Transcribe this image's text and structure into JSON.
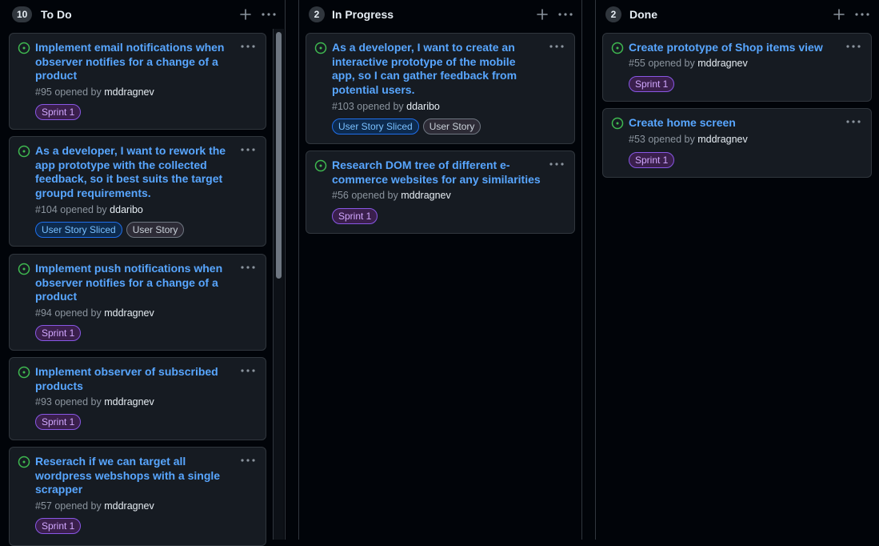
{
  "columns": {
    "todo": {
      "count": "10",
      "title": "To Do",
      "cards": [
        {
          "title_lines": [
            "Implement email notifications when",
            "observer notifies for a change of a",
            "product"
          ],
          "number": "#95",
          "opened_by_text": "opened by",
          "author": "mddragnev",
          "labels": [
            "Sprint 1"
          ]
        },
        {
          "title_lines": [
            "As a developer, I want to rework the",
            "app prototype with the collected",
            "feedback, so it best suits the target",
            "groupd requirements."
          ],
          "number": "#104",
          "opened_by_text": "opened by",
          "author": "ddaribo",
          "labels": [
            "User Story Sliced",
            "User Story"
          ]
        },
        {
          "title_lines": [
            "Implement push notifications when",
            "observer notifies for a change of a",
            "product"
          ],
          "number": "#94",
          "opened_by_text": "opened by",
          "author": "mddragnev",
          "labels": [
            "Sprint 1"
          ]
        },
        {
          "title_lines": [
            "Implement observer of subscribed",
            "products"
          ],
          "number": "#93",
          "opened_by_text": "opened by",
          "author": "mddragnev",
          "labels": [
            "Sprint 1"
          ]
        },
        {
          "title_lines": [
            "Reserach if we can target all",
            "wordpress webshops with a single",
            "scrapper"
          ],
          "number": "#57",
          "opened_by_text": "opened by",
          "author": "mddragnev",
          "labels": [
            "Sprint 1"
          ]
        }
      ]
    },
    "progress": {
      "count": "2",
      "title": "In Progress",
      "cards": [
        {
          "title_lines": [
            "As a developer, I want to create an",
            "interactive prototype of the mobile",
            "app, so I can gather feedback from",
            "potential users."
          ],
          "number": "#103",
          "opened_by_text": "opened by",
          "author": "ddaribo",
          "labels": [
            "User Story Sliced",
            "User Story"
          ]
        },
        {
          "title_lines": [
            "Research DOM tree of different e-",
            "commerce websites for any similarities"
          ],
          "number": "#56",
          "opened_by_text": "opened by",
          "author": "mddragnev",
          "labels": [
            "Sprint 1"
          ]
        }
      ]
    },
    "done": {
      "count": "2",
      "title": "Done",
      "cards": [
        {
          "title_lines": [
            "Create prototype of Shop items view"
          ],
          "number": "#55",
          "opened_by_text": "opened by",
          "author": "mddragnev",
          "labels": [
            "Sprint 1"
          ]
        },
        {
          "title_lines": [
            "Create home screen"
          ],
          "number": "#53",
          "opened_by_text": "opened by",
          "author": "mddragnev",
          "labels": [
            "Sprint 1"
          ]
        }
      ]
    }
  },
  "icons": {
    "status": "issue-opened-icon",
    "add": "plus-icon",
    "menu": "kebab-horizontal-icon"
  },
  "colors": {
    "background": "#010409",
    "card": "#161b22",
    "border": "#30363d",
    "link": "#58a6ff",
    "open_status": "#3fb950",
    "sprint_label": "#d2a8ff",
    "sliced_label": "#79c0ff",
    "story_label": "#c9d1d9"
  }
}
